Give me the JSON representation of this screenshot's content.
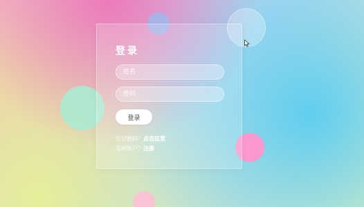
{
  "login": {
    "title": "登录",
    "username_placeholder": "姓名",
    "password_placeholder": "密码",
    "submit_label": "登录",
    "forgot_prompt": "忘记密码？",
    "forgot_link": "点击这里",
    "register_prompt": "没有账户？",
    "register_link": "注册"
  },
  "icons": {
    "cursor": "mouse-pointer-icon"
  },
  "colors": {
    "pink": "#ee6eb4",
    "cyan": "#5acdf0",
    "yellow": "#e8f096",
    "mint": "#aaebd2"
  }
}
